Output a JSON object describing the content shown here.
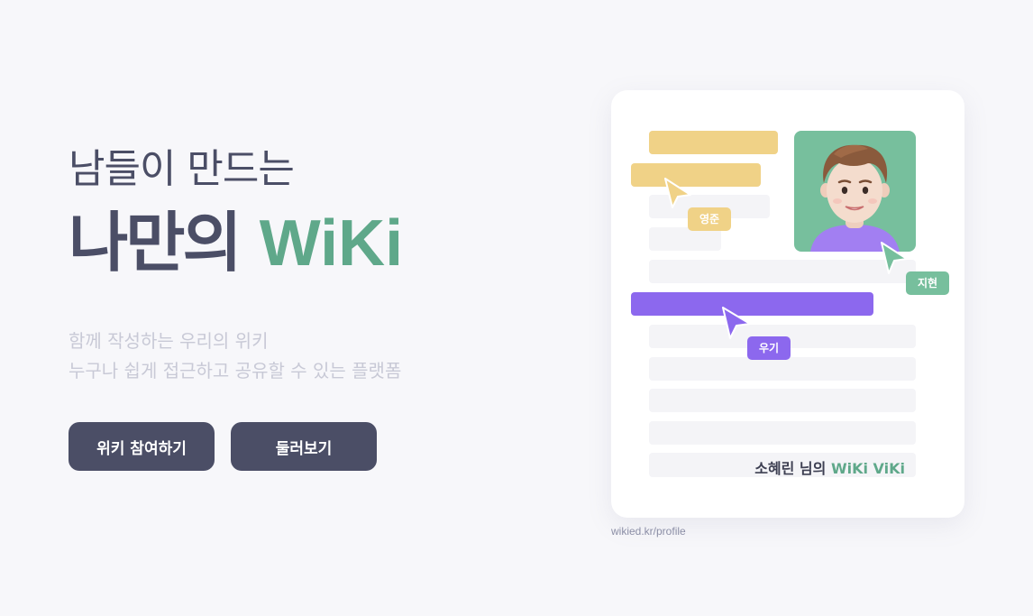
{
  "hero": {
    "eyebrow": "남들이 만드는",
    "headline_prefix": "나만의 ",
    "headline_accent": "WiKi",
    "description_lines": [
      "함께 작성하는 우리의 위키",
      "누구나 쉽게 접근하고 공유할 수 있는 플랫폼"
    ],
    "buttons": {
      "join_label": "위키 참여하기",
      "browse_label": "둘러보기"
    }
  },
  "illustration": {
    "cursor_tags": {
      "yellow": "영준",
      "green": "지현",
      "purple": "우기"
    },
    "wiki_title_prefix": "소혜린 님의 ",
    "wiki_title_accent": "WiKi ViKi",
    "caption": "wikied.kr/profile"
  },
  "colors": {
    "background": "#f7f7fa",
    "primary_dark": "#4b4e66",
    "accent_green": "#5fa88a",
    "highlight_yellow": "#f0d287",
    "highlight_purple": "#8c68ee",
    "avatar_bg": "#77bf9d"
  }
}
